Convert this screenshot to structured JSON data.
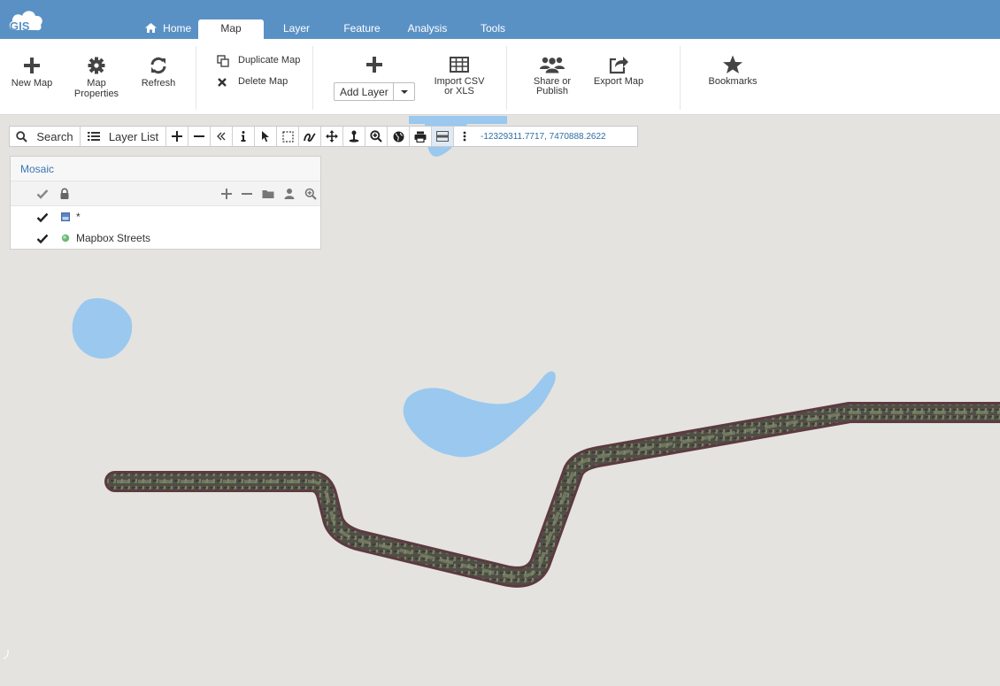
{
  "app": {
    "logo_text": "GIS",
    "brand_color": "#5a91c5"
  },
  "nav": {
    "tabs": [
      {
        "label": "Home",
        "icon": "home-icon"
      },
      {
        "label": "Map",
        "active": true
      },
      {
        "label": "Layer"
      },
      {
        "label": "Feature"
      },
      {
        "label": "Analysis"
      },
      {
        "label": "Tools"
      }
    ]
  },
  "ribbon": {
    "new_map": "New Map",
    "map_properties_1": "Map",
    "map_properties_2": "Properties",
    "refresh": "Refresh",
    "duplicate_map": "Duplicate Map",
    "delete_map": "Delete Map",
    "add_layer": "Add Layer",
    "import_csv_1": "Import CSV",
    "import_csv_2": "or XLS",
    "share_1": "Share or",
    "share_2": "Publish",
    "export_map": "Export Map",
    "bookmarks": "Bookmarks"
  },
  "toolbar": {
    "search": "Search",
    "layer_list": "Layer List",
    "coordinates": "-12329311.7717, 7470888.2622",
    "tools": [
      "zoom-in-icon",
      "zoom-out-icon",
      "collapse-icon",
      "info-icon",
      "select-arrow-icon",
      "box-select-icon",
      "draw-line-icon",
      "pan-icon",
      "location-pin-icon",
      "zoom-magnifier-icon",
      "globe-icon",
      "print-icon",
      "basemap-toggle-icon",
      "more-vertical-icon"
    ]
  },
  "layer_panel": {
    "title": "Mosaic",
    "layers": [
      {
        "name": "*",
        "visible": true,
        "symbol": "raster-icon"
      },
      {
        "name": "Mapbox Streets",
        "visible": true,
        "symbol": "globe-dot-icon"
      }
    ]
  },
  "colors": {
    "water": "#9ac8ef",
    "map_background": "#e4e3df",
    "coordinate_text": "#2e6ca3"
  }
}
